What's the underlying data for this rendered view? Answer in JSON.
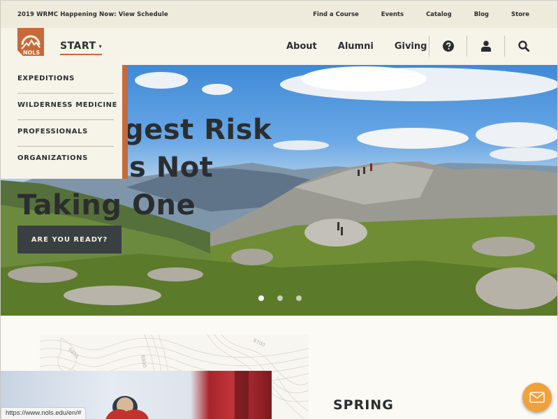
{
  "utility_bar": {
    "promo": "2019 WRMC Happening Now: View Schedule",
    "links": [
      "Find a Course",
      "Events",
      "Catalog",
      "Blog",
      "Store"
    ]
  },
  "header": {
    "logo_text": "NOLS",
    "start_label": "START",
    "nav": [
      "About",
      "Alumni",
      "Giving"
    ],
    "icons": [
      "help-icon",
      "user-icon",
      "search-icon"
    ]
  },
  "dropdown": {
    "items": [
      "EXPEDITIONS",
      "WILDERNESS MEDICINE",
      "PROFESSIONALS",
      "ORGANIZATIONS"
    ]
  },
  "hero": {
    "headline_lines": [
      "The Biggest Risk",
      "Is Not",
      "Taking One"
    ],
    "visible_line1": "gest Risk",
    "visible_line2": "s Not",
    "visible_line3": "Taking One",
    "cta": "ARE YOU READY?",
    "slides": 3,
    "active_slide": 1
  },
  "topo_labels": [
    "9400",
    "8800",
    "8700"
  ],
  "section": {
    "heading": "SPRING"
  },
  "status_bar": {
    "url": "https://www.nols.edu/en/#"
  },
  "colors": {
    "brand_orange": "#c8693a",
    "dark": "#2b2e30",
    "cream": "#f6f3e8",
    "mail_button": "#f1a13a"
  }
}
